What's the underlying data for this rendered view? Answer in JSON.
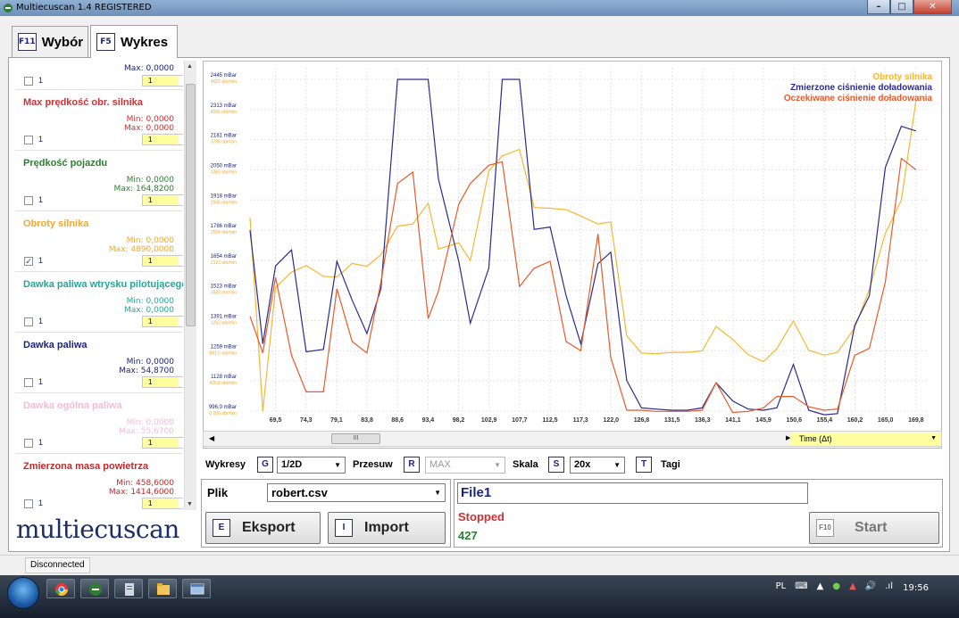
{
  "window": {
    "title": "Multiecuscan 1.4 REGISTERED"
  },
  "tabs": [
    {
      "key": "F11",
      "label": "Wybór"
    },
    {
      "key": "F5",
      "label": "Wykres"
    }
  ],
  "sidebar": {
    "first": {
      "max": "Max: 0,0000",
      "num": "1",
      "sel": "1"
    },
    "items": [
      {
        "name": "Max prędkość obr. silnika",
        "color": "#d32f2f",
        "min": "Min: 0,0000",
        "max": "Max: 0,0000",
        "num": "1",
        "sel": "1",
        "checked": false
      },
      {
        "name": "Prędkość pojazdu",
        "color": "#2e7d32",
        "min": "Min: 0,0000",
        "max": "Max: 164,8200",
        "num": "1",
        "sel": "1",
        "checked": false
      },
      {
        "name": "Obroty silnika",
        "color": "#f0a830",
        "min": "Min: 0,0000",
        "max": "Max: 4890,0000",
        "num": "1",
        "sel": "1",
        "checked": true
      },
      {
        "name": "Dawka paliwa wtrysku pilotującego",
        "color": "#26a69a",
        "min": "Min: 0,0000",
        "max": "Max: 0,0000",
        "num": "1",
        "sel": "1",
        "checked": false
      },
      {
        "name": "Dawka paliwa",
        "color": "#1a237e",
        "min": "Min: 0,0000",
        "max": "Max: 54,8700",
        "num": "1",
        "sel": "1",
        "checked": false
      },
      {
        "name": "Dawka ogólna paliwa",
        "color": "#f8bbd0",
        "min": "Min: 0,0000",
        "max": "Max: 55,6700",
        "num": "1",
        "sel": "1",
        "checked": false
      },
      {
        "name": "Zmierzona masa powietrza",
        "color": "#c62828",
        "min": "Min: 458,6000",
        "max": "Max: 1414,6000",
        "num": "1",
        "sel": "1",
        "checked": false
      }
    ]
  },
  "logo": "multiecuscan",
  "chart_data": {
    "type": "line",
    "x_ticks": [
      "69,5",
      "74,3",
      "79,1",
      "83,8",
      "88,6",
      "93,4",
      "98,2",
      "102,9",
      "107,7",
      "112,5",
      "117,3",
      "122,0",
      "126,8",
      "131,5",
      "136,3",
      "141,1",
      "145,9",
      "150,6",
      "155,4",
      "160,2",
      "165,0",
      "169,8"
    ],
    "y_ticks_mbar": [
      "2445 mBar",
      "2313 mBar",
      "2181 mBar",
      "2050 mBar",
      "1918 mBar",
      "1786 mBar",
      "1654 mBar",
      "1523 mBar",
      "1391 mBar",
      "1259 mBar",
      "1128 mBar",
      "996,0 mBar"
    ],
    "y_ticks_rpm": [
      "4627 obr/min",
      "4206 obr/min",
      "3786 obr/min",
      "3365 obr/min",
      "2945 obr/min",
      "2524 obr/min",
      "2103 obr/min",
      "1683 obr/min",
      "1262 obr/min",
      "841,5 obr/min",
      "420,8 obr/min",
      "0,000 obr/min"
    ],
    "x_range": [
      65.5,
      171.5
    ],
    "series": [
      {
        "name": "Obroty silnika",
        "color": "#f5b733",
        "unit": "obr/min",
        "ylim": [
          0,
          4627
        ],
        "x": [
          65.5,
          67.5,
          69.5,
          72,
          74.3,
          77,
          79.1,
          81.5,
          83.8,
          86,
          88.6,
          91,
          93.4,
          95,
          98.2,
          100,
          102.9,
          105,
          107.7,
          110,
          112.5,
          115,
          117.3,
          120,
          122.0,
          124.5,
          126.8,
          129,
          131.5,
          134,
          136.3,
          138.5,
          141.1,
          143.5,
          145.9,
          148,
          150.6,
          153,
          155.4,
          157.5,
          160.2,
          162.5,
          165.0,
          167.5,
          169.8
        ],
        "values": [
          2700,
          0,
          1720,
          1940,
          2030,
          1880,
          1870,
          2060,
          2020,
          2180,
          2580,
          2610,
          2900,
          2260,
          2350,
          2100,
          3350,
          3560,
          3650,
          2840,
          2830,
          2810,
          2720,
          2610,
          2640,
          1050,
          810,
          800,
          820,
          820,
          840,
          1180,
          1000,
          790,
          690,
          870,
          1260,
          850,
          780,
          820,
          1160,
          1700,
          2480,
          2940,
          4330
        ]
      },
      {
        "name": "Zmierzone ciśnienie doładowania",
        "color": "#2b2b8c",
        "unit": "mBar",
        "ylim": [
          996,
          2445
        ],
        "x": [
          65.5,
          67.5,
          69.5,
          72,
          74.3,
          77,
          79.1,
          81.5,
          83.8,
          86,
          88.6,
          91,
          93.4,
          95,
          98.2,
          100,
          102.9,
          105,
          107.7,
          110,
          112.5,
          115,
          117.3,
          120,
          122.0,
          124.5,
          126.8,
          129,
          131.5,
          134,
          136.3,
          138.5,
          141.1,
          143.5,
          145.9,
          148,
          150.6,
          153,
          155.4,
          157.5,
          160.2,
          162.5,
          165.0,
          167.5,
          169.8
        ],
        "values": [
          1786,
          1290,
          1630,
          1700,
          1255,
          1265,
          1650,
          1480,
          1335,
          1530,
          2445,
          2445,
          2445,
          2010,
          1650,
          1380,
          1620,
          2445,
          2445,
          1790,
          1800,
          1500,
          1290,
          1640,
          1690,
          1130,
          1010,
          1005,
          1000,
          1000,
          1010,
          1120,
          1040,
          1005,
          1000,
          1010,
          1200,
          1000,
          980,
          985,
          1370,
          1500,
          2060,
          2240,
          2220
        ]
      },
      {
        "name": "Oczekiwane ciśnienie doładowania",
        "color": "#e85a2a",
        "unit": "mBar",
        "ylim": [
          996,
          2445
        ],
        "x": [
          65.5,
          67.5,
          69.5,
          72,
          74.3,
          77,
          79.1,
          81.5,
          83.8,
          86,
          88.6,
          91,
          93.4,
          95,
          98.2,
          100,
          102.9,
          105,
          107.7,
          110,
          112.5,
          115,
          117.3,
          120,
          122.0,
          124.5,
          126.8,
          129,
          131.5,
          134,
          136.3,
          138.5,
          141.1,
          143.5,
          145.9,
          148,
          150.6,
          153,
          155.4,
          157.5,
          160.2,
          162.5,
          165.0,
          167.5,
          169.8
        ],
        "values": [
          1410,
          1250,
          1580,
          1240,
          1080,
          1080,
          1530,
          1300,
          1250,
          1560,
          1990,
          2040,
          1400,
          1520,
          1900,
          1990,
          2070,
          2085,
          1540,
          1620,
          1650,
          1300,
          1260,
          1770,
          1230,
          1000,
          1000,
          995,
          995,
          995,
          1000,
          1120,
          990,
          995,
          1010,
          1060,
          1060,
          1015,
          1000,
          1005,
          1240,
          1270,
          1560,
          2100,
          2050
        ]
      }
    ]
  },
  "chart": {
    "legend": [
      "Obroty silnika",
      "Zmierzone ciśnienie doładowania",
      "Oczekiwane ciśnienie doładowania"
    ],
    "scroll_thumb": "III",
    "time_axis": "Time (Δt)"
  },
  "toolbar": {
    "wykresy_label": "Wykresy",
    "wykresy_key": "G",
    "wykresy_value": "1/2D",
    "przesuw_label": "Przesuw",
    "przesuw_key": "R",
    "przesuw_value": "MAX",
    "skala_label": "Skala",
    "skala_key": "S",
    "skala_value": "20x",
    "tagi_key": "T",
    "tagi_label": "Tagi"
  },
  "file": {
    "plik_label": "Plik",
    "plik_value": "robert.csv",
    "export_key": "E",
    "export_label": "Eksport",
    "import_key": "I",
    "import_label": "Import",
    "name_value": "File1",
    "status": "Stopped",
    "count": "427",
    "start_key": "F10",
    "start_label": "Start"
  },
  "statusbar": {
    "connection": "Disconnected"
  },
  "taskbar": {
    "lang": "PL",
    "time": "19:56"
  }
}
